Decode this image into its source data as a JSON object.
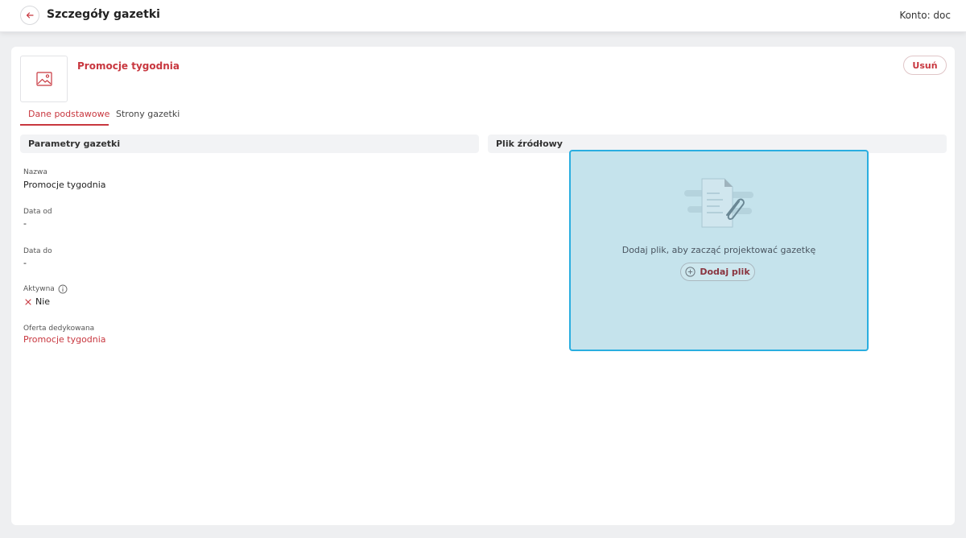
{
  "header": {
    "title": "Szczegóły gazetki",
    "account": "Konto: doc"
  },
  "card": {
    "name": "Promocje tygodnia",
    "delete_label": "Usuń"
  },
  "tabs": [
    {
      "label": "Dane podstawowe",
      "active": true
    },
    {
      "label": "Strony gazetki",
      "active": false
    }
  ],
  "params": {
    "section_title": "Parametry gazetki",
    "fields": [
      {
        "label": "Nazwa",
        "value": "Promocje tygodnia"
      },
      {
        "label": "Data od",
        "value": "-"
      },
      {
        "label": "Data do",
        "value": "-"
      },
      {
        "label": "Aktywna",
        "value": "Nie"
      },
      {
        "label": "Oferta dedykowana",
        "value": "Promocje tygodnia"
      }
    ]
  },
  "source": {
    "section_title": "Plik źródłowy",
    "drop_text": "Dodaj plik, aby zacząć projektować gazetkę",
    "add_file_label": "Dodaj plik"
  },
  "colors": {
    "accent": "#c8373f",
    "dropzone_bg": "#c5e3ec",
    "dropzone_border": "#2aaee0"
  },
  "icons": [
    "arrow-left-icon",
    "image-icon",
    "info-icon",
    "close-icon",
    "paperclip-document-icon",
    "plus-circle-icon"
  ]
}
